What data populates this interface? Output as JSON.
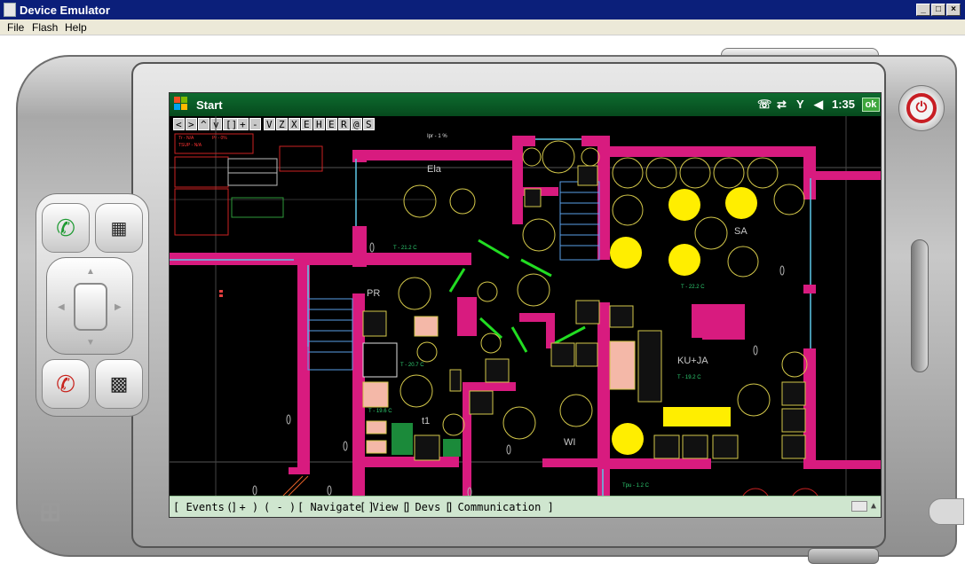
{
  "window": {
    "title": "Device Emulator",
    "buttons": [
      "_",
      "□",
      "×"
    ]
  },
  "menu": {
    "items": [
      "File",
      "Flash",
      "Help"
    ]
  },
  "taskbar": {
    "start_label": "Start",
    "time": "1:35",
    "ok_label": "ok",
    "icons": [
      "message-icon",
      "sync-icon",
      "signal-icon",
      "volume-icon"
    ]
  },
  "toolbar": {
    "buttons": [
      "<",
      ">",
      "^",
      "v",
      "[]",
      "+",
      "-",
      "V",
      "Z",
      "X",
      "E",
      "H",
      "E",
      "R",
      "@",
      "S"
    ]
  },
  "plan": {
    "header_text": "Ipr - 1 %",
    "rooms": {
      "ela": "Ela",
      "sa": "SA",
      "pr": "PR",
      "ku_ja": "KU+JA",
      "wi": "WI",
      "t1": "t1"
    },
    "temps": {
      "ela": "T - 21.2 C",
      "sa": "T - 22.2 C",
      "pr": "T - 20.7 C",
      "ku": "T - 19.2 C",
      "t1": "T - 19.6 C",
      "bottom": "Tpu - 1.2 C"
    },
    "colors": {
      "wall": "#d81b7f",
      "lamp_on": "#ffee00",
      "lamp_off": "#d4c84a",
      "window": "#5ec8e8",
      "door": "#22dd22"
    }
  },
  "bottombar": {
    "items": [
      "[ Events ]",
      "( + )",
      "( - )",
      "[ Navigate ]",
      "[ View ]",
      "[ Devs ]",
      "[ Communication ]"
    ]
  }
}
